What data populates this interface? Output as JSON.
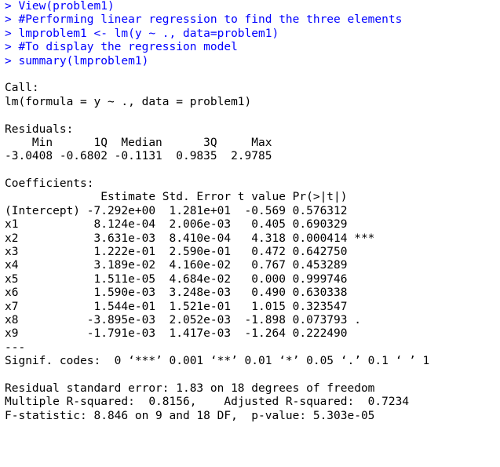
{
  "colors": {
    "command": "#0000ff",
    "output": "#000000",
    "background": "#ffffff"
  },
  "commands": [
    "> View(problem1)",
    "> #Performing linear regression to find the three elements",
    "> lmproblem1 <- lm(y ~ ., data=problem1)",
    "> #To display the regression model",
    "> summary(lmproblem1)"
  ],
  "call": {
    "header": "Call:",
    "formula": "lm(formula = y ~ ., data = problem1)"
  },
  "residuals": {
    "header": "Residuals:",
    "labels_line": "    Min      1Q  Median      3Q     Max ",
    "values_line": "-3.0408 -0.6802 -0.1131  0.9835  2.9785 ",
    "labels": [
      "Min",
      "1Q",
      "Median",
      "3Q",
      "Max"
    ],
    "values": [
      -3.0408,
      -0.6802,
      -0.1131,
      0.9835,
      2.9785
    ]
  },
  "coefficients": {
    "header": "Coefficients:",
    "columns_line": "              Estimate Std. Error t value Pr(>|t|)    ",
    "columns": [
      "Estimate",
      "Std. Error",
      "t value",
      "Pr(>|t|)"
    ],
    "rows": [
      {
        "line": "(Intercept) -7.292e+00  1.281e+01  -0.569 0.576312    ",
        "name": "(Intercept)",
        "estimate": "-7.292e+00",
        "std_error": "1.281e+01",
        "t_value": "-0.569",
        "p_value": "0.576312",
        "signif": ""
      },
      {
        "line": "x1           8.124e-04  2.006e-03   0.405 0.690329    ",
        "name": "x1",
        "estimate": "8.124e-04",
        "std_error": "2.006e-03",
        "t_value": "0.405",
        "p_value": "0.690329",
        "signif": ""
      },
      {
        "line": "x2           3.631e-03  8.410e-04   4.318 0.000414 ***",
        "name": "x2",
        "estimate": "3.631e-03",
        "std_error": "8.410e-04",
        "t_value": "4.318",
        "p_value": "0.000414",
        "signif": "***"
      },
      {
        "line": "x3           1.222e-01  2.590e-01   0.472 0.642750    ",
        "name": "x3",
        "estimate": "1.222e-01",
        "std_error": "2.590e-01",
        "t_value": "0.472",
        "p_value": "0.642750",
        "signif": ""
      },
      {
        "line": "x4           3.189e-02  4.160e-02   0.767 0.453289    ",
        "name": "x4",
        "estimate": "3.189e-02",
        "std_error": "4.160e-02",
        "t_value": "0.767",
        "p_value": "0.453289",
        "signif": ""
      },
      {
        "line": "x5           1.511e-05  4.684e-02   0.000 0.999746    ",
        "name": "x5",
        "estimate": "1.511e-05",
        "std_error": "4.684e-02",
        "t_value": "0.000",
        "p_value": "0.999746",
        "signif": ""
      },
      {
        "line": "x6           1.590e-03  3.248e-03   0.490 0.630338    ",
        "name": "x6",
        "estimate": "1.590e-03",
        "std_error": "3.248e-03",
        "t_value": "0.490",
        "p_value": "0.630338",
        "signif": ""
      },
      {
        "line": "x7           1.544e-01  1.521e-01   1.015 0.323547    ",
        "name": "x7",
        "estimate": "1.544e-01",
        "std_error": "1.521e-01",
        "t_value": "1.015",
        "p_value": "0.323547",
        "signif": ""
      },
      {
        "line": "x8          -3.895e-03  2.052e-03  -1.898 0.073793 .  ",
        "name": "x8",
        "estimate": "-3.895e-03",
        "std_error": "2.052e-03",
        "t_value": "-1.898",
        "p_value": "0.073793",
        "signif": "."
      },
      {
        "line": "x9          -1.791e-03  1.417e-03  -1.264 0.222490    ",
        "name": "x9",
        "estimate": "-1.791e-03",
        "std_error": "1.417e-03",
        "t_value": "-1.264",
        "p_value": "0.222490",
        "signif": ""
      }
    ],
    "separator": "---",
    "signif_codes": "Signif. codes:  0 ‘***’ 0.001 ‘**’ 0.01 ‘*’ 0.05 ‘.’ 0.1 ‘ ’ 1"
  },
  "fit_stats": {
    "residual_se": "Residual standard error: 1.83 on 18 degrees of freedom",
    "r_squared": "Multiple R-squared:  0.8156,\tAdjusted R-squared:  0.7234 ",
    "f_statistic": "F-statistic: 8.846 on 9 and 18 DF,  p-value: 5.303e-05"
  }
}
